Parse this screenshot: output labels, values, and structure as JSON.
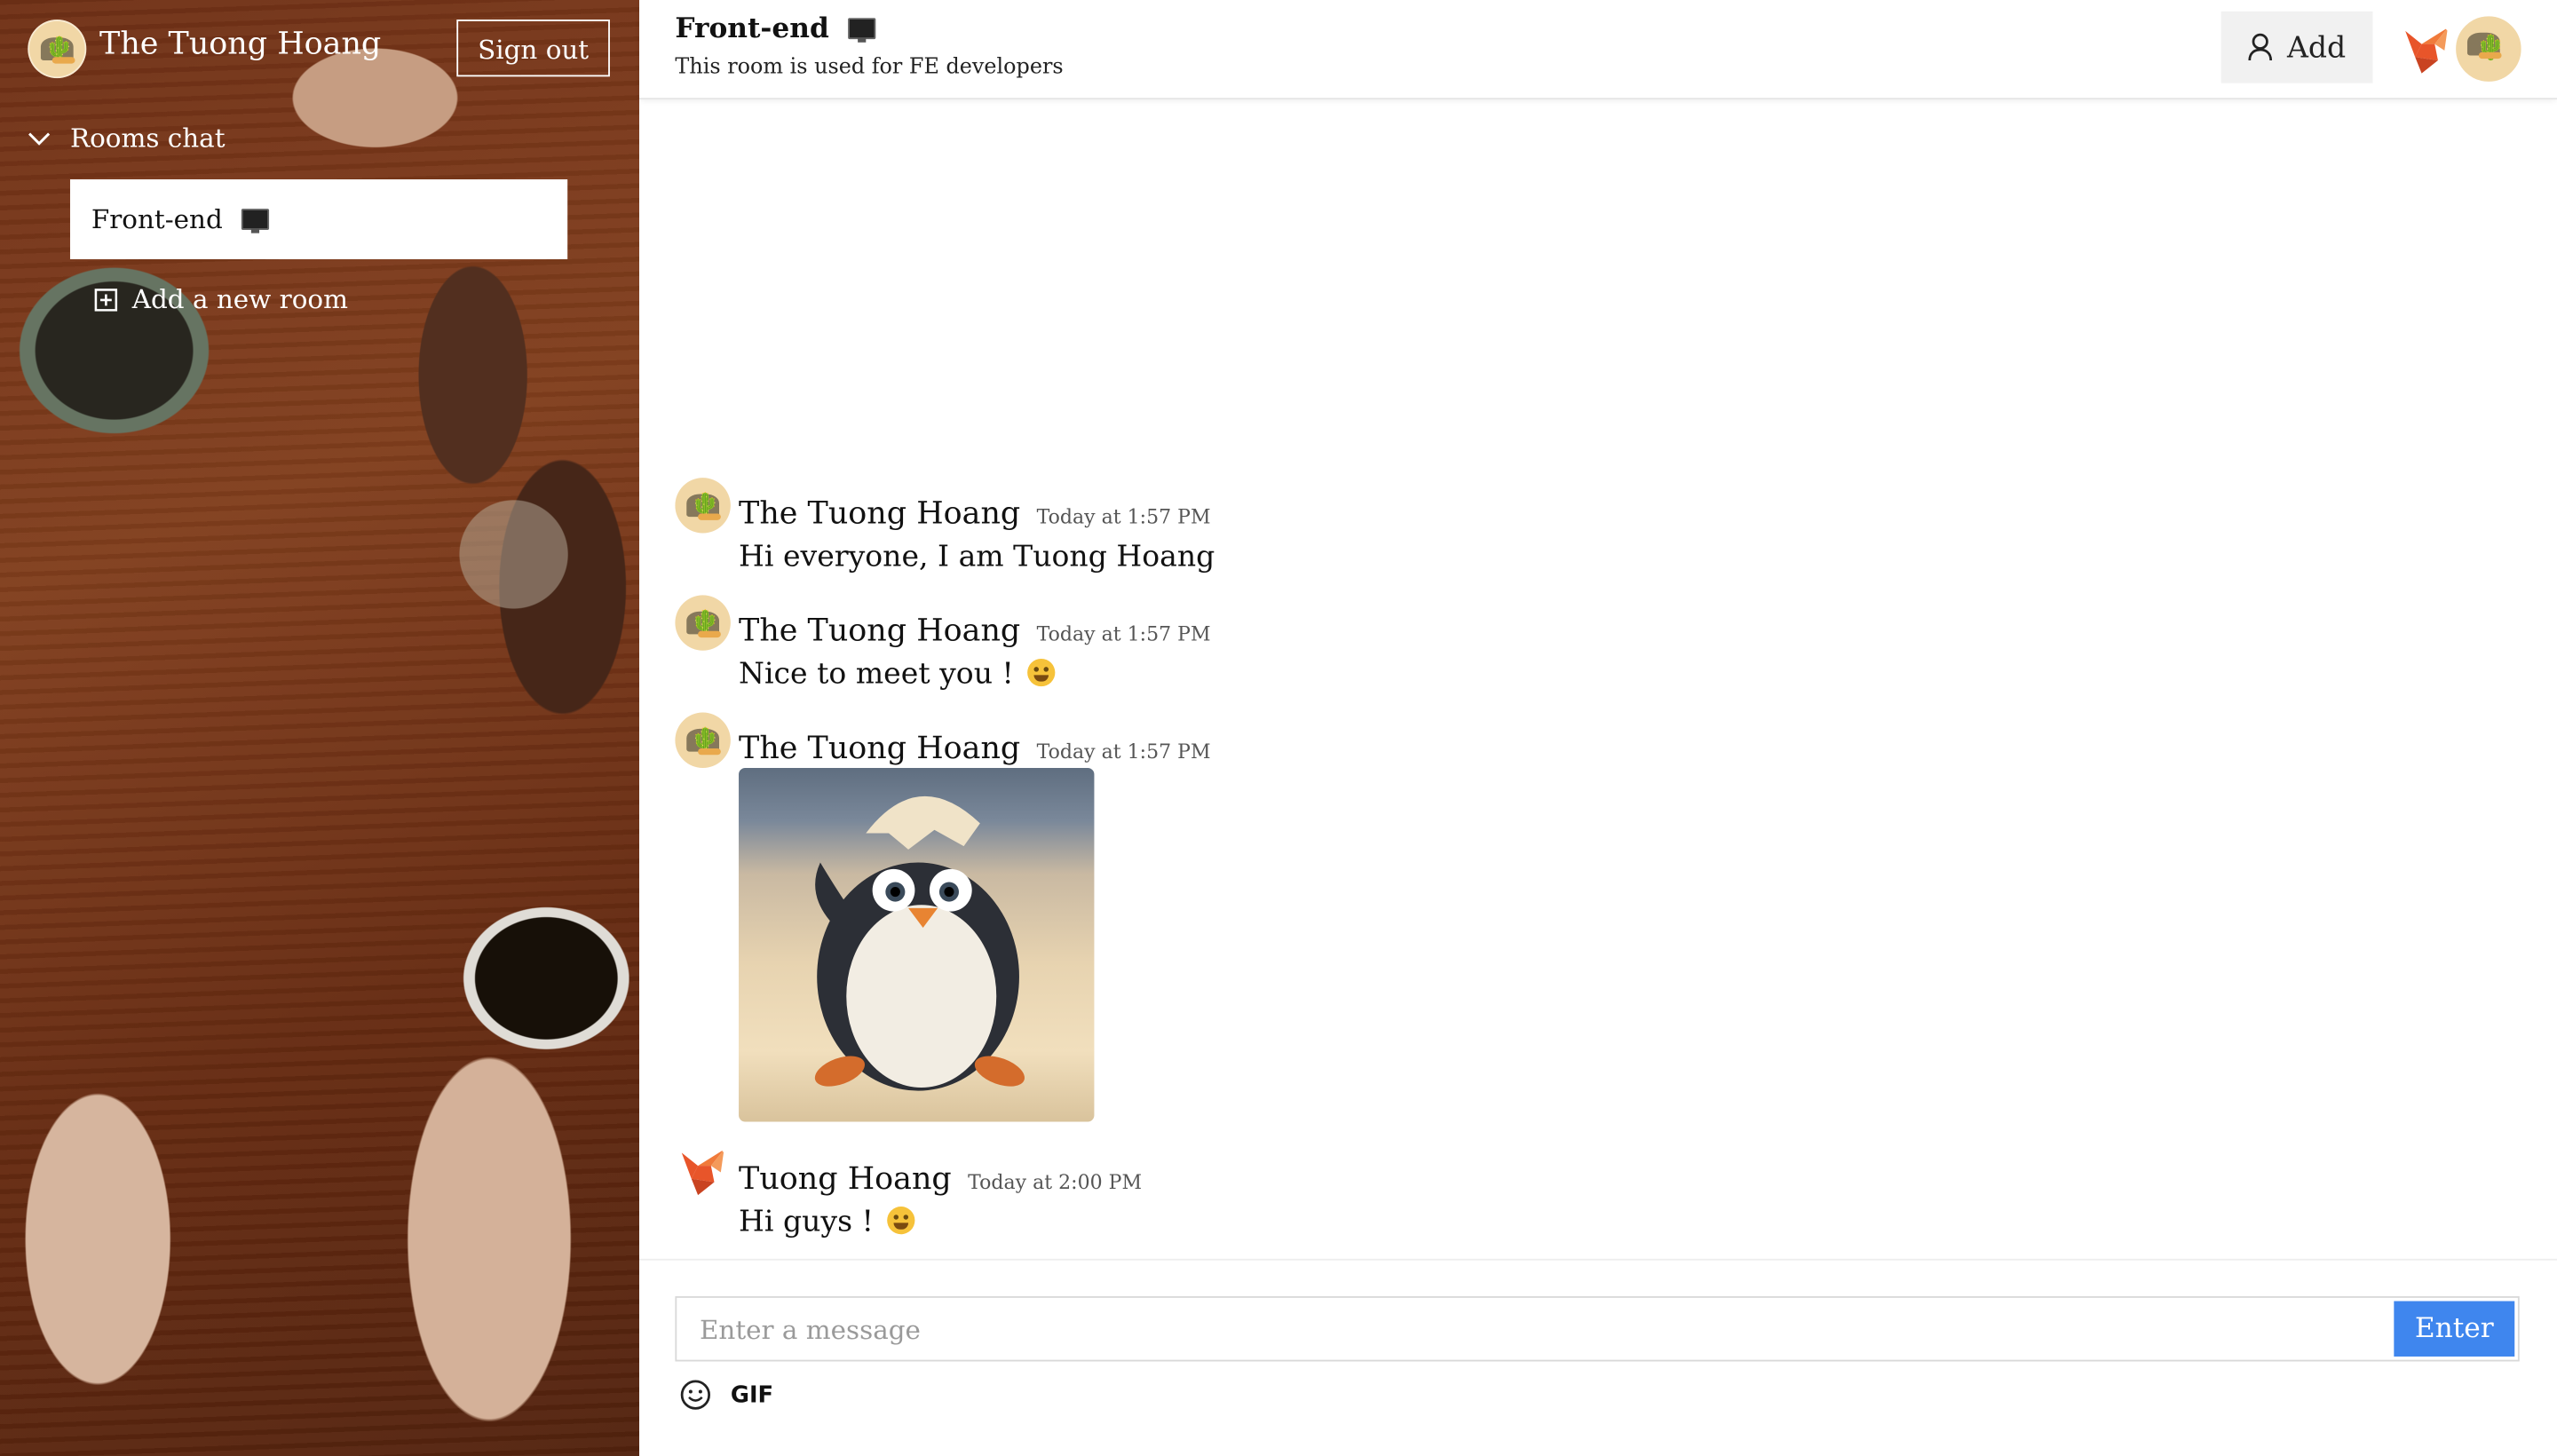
{
  "current_user": {
    "name": "The Tuong Hoang",
    "avatar_icon": "dino-avatar-icon"
  },
  "sidebar": {
    "sign_out_label": "Sign out",
    "rooms_header": "Rooms chat",
    "rooms": [
      {
        "label": "Front-end",
        "icon": "monitor-icon"
      }
    ],
    "add_room_label": "Add a new room"
  },
  "header": {
    "room_title": "Front-end",
    "room_description": "This room is used for FE developers",
    "add_label": "Add",
    "members": [
      "fox-avatar",
      "dino-avatar"
    ]
  },
  "messages": [
    {
      "author": "The Tuong Hoang",
      "time": "Today at 1:57 PM",
      "text": "Hi everyone, I am Tuong Hoang",
      "avatar": "dino"
    },
    {
      "author": "The Tuong Hoang",
      "time": "Today at 1:57 PM",
      "text": "Nice to meet you ! ",
      "emoji": "hugging-face-emoji",
      "avatar": "dino"
    },
    {
      "author": "The Tuong Hoang",
      "time": "Today at 1:57 PM",
      "image": "penguin-gif",
      "avatar": "dino"
    },
    {
      "author": "Tuong Hoang",
      "time": "Today at 2:00 PM",
      "text": "Hi guys ! ",
      "emoji": "grinning-face-emoji",
      "avatar": "fox"
    }
  ],
  "composer": {
    "placeholder": "Enter a message",
    "value": "",
    "send_label": "Enter",
    "gif_label": "GIF"
  },
  "colors": {
    "accent": "#3f86ee",
    "room_bg": "#ffffff"
  }
}
